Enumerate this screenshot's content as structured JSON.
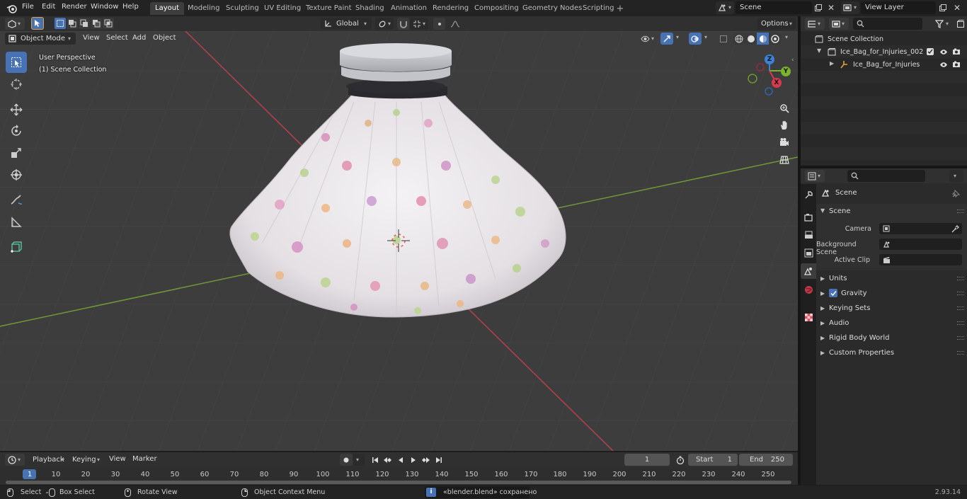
{
  "menu": {
    "items": [
      "File",
      "Edit",
      "Render",
      "Window",
      "Help"
    ]
  },
  "workspaces": [
    "Layout",
    "Modeling",
    "Sculpting",
    "UV Editing",
    "Texture Paint",
    "Shading",
    "Animation",
    "Rendering",
    "Compositing",
    "Geometry Nodes",
    "Scripting"
  ],
  "scene_field": {
    "value": "Scene"
  },
  "viewlayer_field": {
    "value": "View Layer"
  },
  "viewport": {
    "mode": "Object Mode",
    "menus": [
      "View",
      "Select",
      "Add",
      "Object"
    ],
    "transform_orientation": "Global",
    "options_label": "Options",
    "perspective_label": "User Perspective",
    "collection_label": "(1) Scene Collection",
    "gizmo": {
      "x": "X",
      "y": "Y",
      "z": "Z"
    }
  },
  "outliner": {
    "root": "Scene Collection",
    "collection": "Ice_Bag_for_Injuries_002",
    "object": "Ice_Bag_for_Injuries"
  },
  "properties": {
    "context_label": "Scene",
    "panel_title": "Scene",
    "camera_label": "Camera",
    "background_scene_label": "Background Scene",
    "active_clip_label": "Active Clip",
    "sections": [
      "Units",
      "Gravity",
      "Keying Sets",
      "Audio",
      "Rigid Body World",
      "Custom Properties"
    ],
    "gravity_checked": true
  },
  "timeline": {
    "menus": [
      "Playback",
      "Keying",
      "View",
      "Marker"
    ],
    "current_frame": "1",
    "start_label": "Start",
    "start_value": "1",
    "end_label": "End",
    "end_value": "250",
    "ticks": [
      "1",
      "10",
      "20",
      "30",
      "40",
      "50",
      "60",
      "70",
      "80",
      "90",
      "100",
      "110",
      "120",
      "130",
      "140",
      "150",
      "160",
      "170",
      "180",
      "190",
      "200",
      "210",
      "220",
      "230",
      "240",
      "250"
    ]
  },
  "status": {
    "select": "Select",
    "box_select": "Box Select",
    "rotate_view": "Rotate View",
    "context_menu": "Object Context Menu",
    "message": "«blender.blend» сохранено",
    "version": "2.93.14"
  },
  "colors": {
    "accent": "#4772b3",
    "x_axis": "#d8394e",
    "y_axis": "#7ab32d",
    "z_axis": "#3b82d6",
    "viewport_bg": "#3d3d3d"
  }
}
